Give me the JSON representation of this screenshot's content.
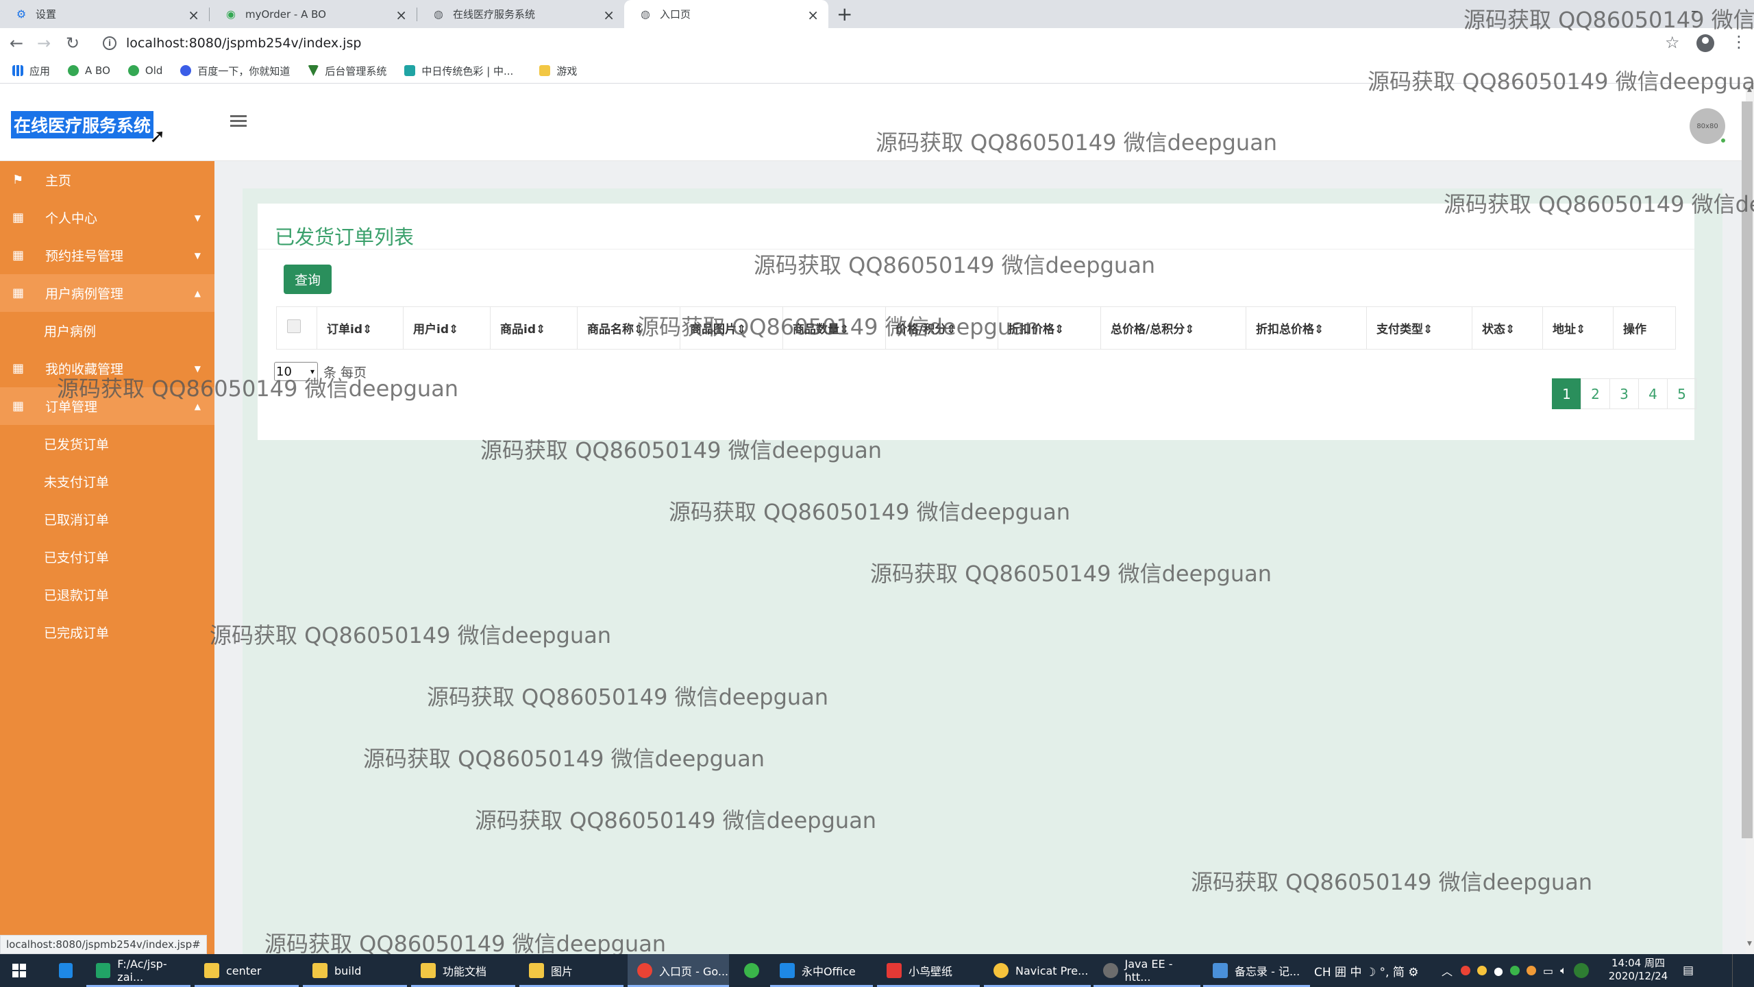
{
  "browser": {
    "tabs": [
      {
        "label": "设置",
        "icon": "gear-icon"
      },
      {
        "label": "myOrder - A BO",
        "icon": "globe-icon"
      },
      {
        "label": "在线医疗服务系统",
        "icon": "globe-icon"
      },
      {
        "label": "入口页",
        "icon": "globe-icon"
      }
    ],
    "url": "localhost:8080/jspmb254v/index.jsp",
    "bookmarks": [
      {
        "label": "应用",
        "color": "#1a73e8"
      },
      {
        "label": "A BO",
        "color": "#34a853"
      },
      {
        "label": "Old",
        "color": "#34a853"
      },
      {
        "label": "百度一下，你就知道",
        "color": "#3b5de7"
      },
      {
        "label": "后台管理系统",
        "color": "#2e7d32"
      },
      {
        "label": "中日传统色彩 | 中...",
        "color": "#20a4a4"
      },
      {
        "label": "游戏",
        "color": "#f2c744"
      }
    ],
    "status_url": "localhost:8080/jspmb254v/index.jsp#"
  },
  "app": {
    "title": "在线医疗服务系统",
    "avatar_text": "80x80"
  },
  "sidebar": {
    "items": [
      {
        "label": "主页",
        "icon": "flag-icon",
        "arrow": ""
      },
      {
        "label": "个人中心",
        "icon": "grid-icon",
        "arrow": "▼"
      },
      {
        "label": "预约挂号管理",
        "icon": "grid-icon",
        "arrow": "▼"
      },
      {
        "label": "用户病例管理",
        "icon": "grid-icon",
        "arrow": "▲"
      },
      {
        "label": "用户病例",
        "icon": "",
        "arrow": ""
      },
      {
        "label": "我的收藏管理",
        "icon": "grid-icon",
        "arrow": "▼"
      },
      {
        "label": "订单管理",
        "icon": "grid-icon",
        "arrow": "▲"
      },
      {
        "label": "已发货订单",
        "icon": "",
        "arrow": ""
      },
      {
        "label": "未支付订单",
        "icon": "",
        "arrow": ""
      },
      {
        "label": "已取消订单",
        "icon": "",
        "arrow": ""
      },
      {
        "label": "已支付订单",
        "icon": "",
        "arrow": ""
      },
      {
        "label": "已退款订单",
        "icon": "",
        "arrow": ""
      },
      {
        "label": "已完成订单",
        "icon": "",
        "arrow": ""
      }
    ]
  },
  "main": {
    "title": "已发货订单列表",
    "query_button": "查询",
    "columns": [
      "订单id⇕",
      "用户id⇕",
      "商品id⇕",
      "商品名称⇕",
      "商品图片⇕",
      "商品数量⇕",
      "价格/积分⇕",
      "折扣价格⇕",
      "总价格/总积分⇕",
      "折扣总价格⇕",
      "支付类型⇕",
      "状态⇕",
      "地址⇕",
      "操作"
    ],
    "page_size": "10",
    "page_size_suffix": "条 每页",
    "pages": [
      "1",
      "2",
      "3",
      "4",
      "5"
    ],
    "current_page": "1"
  },
  "watermark": "源码获取 QQ86050149 微信deepguan",
  "taskbar": {
    "items": [
      {
        "label": "F:/Ac/jsp-zai...",
        "color": "#21a366"
      },
      {
        "label": "center",
        "color": "#f2c744"
      },
      {
        "label": "build",
        "color": "#f2c744"
      },
      {
        "label": "功能文档",
        "color": "#f2c744"
      },
      {
        "label": "图片",
        "color": "#f2c744"
      },
      {
        "label": "入口页 - Go...",
        "color": "#ea4335"
      },
      {
        "label": "",
        "color": "#3ab54a"
      },
      {
        "label": "永中Office",
        "color": "#1e88e5"
      },
      {
        "label": "小鸟壁纸",
        "color": "#e53935"
      },
      {
        "label": "Navicat Pre...",
        "color": "#f6c33c"
      },
      {
        "label": "Java EE - htt...",
        "color": "#6d6d6d"
      },
      {
        "label": "备忘录 - 记...",
        "color": "#4a90d9"
      }
    ],
    "ime": "CH 囲 中 ☽ °, 简 ⚙",
    "clock_time": "14:04 周四",
    "clock_date": "2020/12/24"
  },
  "colors": {
    "sidebar": "#ec8b3a",
    "accent_green": "#2a8f5c",
    "title_green": "#3aa06b",
    "logo_highlight": "#1a73e8"
  }
}
